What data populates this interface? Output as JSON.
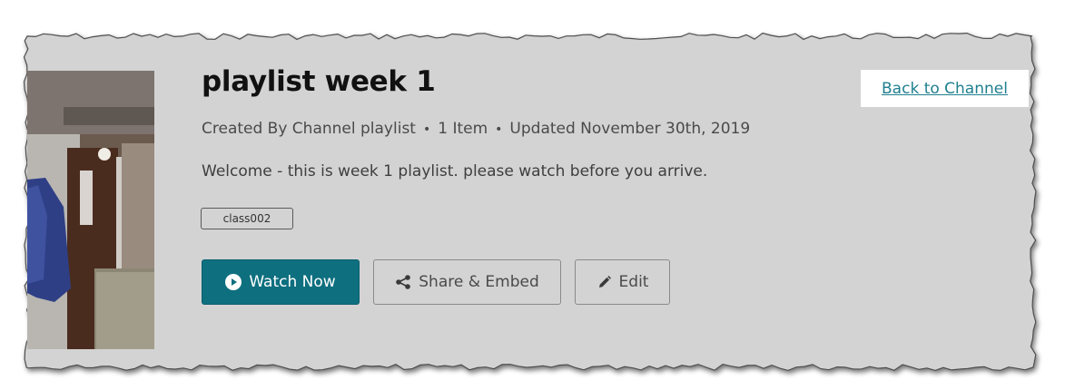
{
  "playlist": {
    "title": "playlist week 1",
    "created_by": "Created By Channel playlist",
    "item_count": "1 Item",
    "updated": "Updated November 30th, 2019",
    "separator": "•",
    "description": "Welcome - this is week 1 playlist. please watch before you arrive.",
    "tag": "class002"
  },
  "actions": {
    "watch_label": "Watch Now",
    "share_label": "Share & Embed",
    "edit_label": "Edit"
  },
  "nav": {
    "back_label": "Back to Channel"
  },
  "colors": {
    "panel_bg": "#d3d3d3",
    "accent": "#0e6f7f",
    "link": "#1f7f8f"
  },
  "icons": {
    "watch": "play-circle-icon",
    "share": "share-icon",
    "edit": "pencil-icon"
  }
}
